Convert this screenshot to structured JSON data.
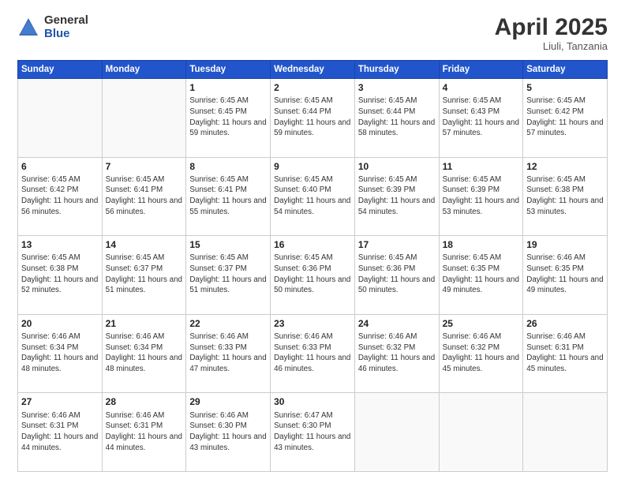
{
  "header": {
    "logo_general": "General",
    "logo_blue": "Blue",
    "month": "April 2025",
    "location": "Liuli, Tanzania"
  },
  "days_of_week": [
    "Sunday",
    "Monday",
    "Tuesday",
    "Wednesday",
    "Thursday",
    "Friday",
    "Saturday"
  ],
  "weeks": [
    [
      {
        "day": "",
        "content": ""
      },
      {
        "day": "",
        "content": ""
      },
      {
        "day": "1",
        "content": "Sunrise: 6:45 AM\nSunset: 6:45 PM\nDaylight: 11 hours and 59 minutes."
      },
      {
        "day": "2",
        "content": "Sunrise: 6:45 AM\nSunset: 6:44 PM\nDaylight: 11 hours and 59 minutes."
      },
      {
        "day": "3",
        "content": "Sunrise: 6:45 AM\nSunset: 6:44 PM\nDaylight: 11 hours and 58 minutes."
      },
      {
        "day": "4",
        "content": "Sunrise: 6:45 AM\nSunset: 6:43 PM\nDaylight: 11 hours and 57 minutes."
      },
      {
        "day": "5",
        "content": "Sunrise: 6:45 AM\nSunset: 6:42 PM\nDaylight: 11 hours and 57 minutes."
      }
    ],
    [
      {
        "day": "6",
        "content": "Sunrise: 6:45 AM\nSunset: 6:42 PM\nDaylight: 11 hours and 56 minutes."
      },
      {
        "day": "7",
        "content": "Sunrise: 6:45 AM\nSunset: 6:41 PM\nDaylight: 11 hours and 56 minutes."
      },
      {
        "day": "8",
        "content": "Sunrise: 6:45 AM\nSunset: 6:41 PM\nDaylight: 11 hours and 55 minutes."
      },
      {
        "day": "9",
        "content": "Sunrise: 6:45 AM\nSunset: 6:40 PM\nDaylight: 11 hours and 54 minutes."
      },
      {
        "day": "10",
        "content": "Sunrise: 6:45 AM\nSunset: 6:39 PM\nDaylight: 11 hours and 54 minutes."
      },
      {
        "day": "11",
        "content": "Sunrise: 6:45 AM\nSunset: 6:39 PM\nDaylight: 11 hours and 53 minutes."
      },
      {
        "day": "12",
        "content": "Sunrise: 6:45 AM\nSunset: 6:38 PM\nDaylight: 11 hours and 53 minutes."
      }
    ],
    [
      {
        "day": "13",
        "content": "Sunrise: 6:45 AM\nSunset: 6:38 PM\nDaylight: 11 hours and 52 minutes."
      },
      {
        "day": "14",
        "content": "Sunrise: 6:45 AM\nSunset: 6:37 PM\nDaylight: 11 hours and 51 minutes."
      },
      {
        "day": "15",
        "content": "Sunrise: 6:45 AM\nSunset: 6:37 PM\nDaylight: 11 hours and 51 minutes."
      },
      {
        "day": "16",
        "content": "Sunrise: 6:45 AM\nSunset: 6:36 PM\nDaylight: 11 hours and 50 minutes."
      },
      {
        "day": "17",
        "content": "Sunrise: 6:45 AM\nSunset: 6:36 PM\nDaylight: 11 hours and 50 minutes."
      },
      {
        "day": "18",
        "content": "Sunrise: 6:45 AM\nSunset: 6:35 PM\nDaylight: 11 hours and 49 minutes."
      },
      {
        "day": "19",
        "content": "Sunrise: 6:46 AM\nSunset: 6:35 PM\nDaylight: 11 hours and 49 minutes."
      }
    ],
    [
      {
        "day": "20",
        "content": "Sunrise: 6:46 AM\nSunset: 6:34 PM\nDaylight: 11 hours and 48 minutes."
      },
      {
        "day": "21",
        "content": "Sunrise: 6:46 AM\nSunset: 6:34 PM\nDaylight: 11 hours and 48 minutes."
      },
      {
        "day": "22",
        "content": "Sunrise: 6:46 AM\nSunset: 6:33 PM\nDaylight: 11 hours and 47 minutes."
      },
      {
        "day": "23",
        "content": "Sunrise: 6:46 AM\nSunset: 6:33 PM\nDaylight: 11 hours and 46 minutes."
      },
      {
        "day": "24",
        "content": "Sunrise: 6:46 AM\nSunset: 6:32 PM\nDaylight: 11 hours and 46 minutes."
      },
      {
        "day": "25",
        "content": "Sunrise: 6:46 AM\nSunset: 6:32 PM\nDaylight: 11 hours and 45 minutes."
      },
      {
        "day": "26",
        "content": "Sunrise: 6:46 AM\nSunset: 6:31 PM\nDaylight: 11 hours and 45 minutes."
      }
    ],
    [
      {
        "day": "27",
        "content": "Sunrise: 6:46 AM\nSunset: 6:31 PM\nDaylight: 11 hours and 44 minutes."
      },
      {
        "day": "28",
        "content": "Sunrise: 6:46 AM\nSunset: 6:31 PM\nDaylight: 11 hours and 44 minutes."
      },
      {
        "day": "29",
        "content": "Sunrise: 6:46 AM\nSunset: 6:30 PM\nDaylight: 11 hours and 43 minutes."
      },
      {
        "day": "30",
        "content": "Sunrise: 6:47 AM\nSunset: 6:30 PM\nDaylight: 11 hours and 43 minutes."
      },
      {
        "day": "",
        "content": ""
      },
      {
        "day": "",
        "content": ""
      },
      {
        "day": "",
        "content": ""
      }
    ]
  ]
}
